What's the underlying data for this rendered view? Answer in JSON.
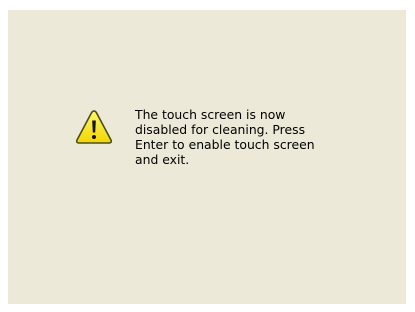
{
  "dialog": {
    "icon": "warning-icon",
    "message": "The touch screen is now\ndisabled for cleaning.  Press\nEnter to enable touch screen\nand exit.",
    "colors": {
      "background": "#ece9d8",
      "icon_fill": "#ffee00",
      "icon_stroke": "#5a5a00",
      "text": "#000000"
    }
  }
}
